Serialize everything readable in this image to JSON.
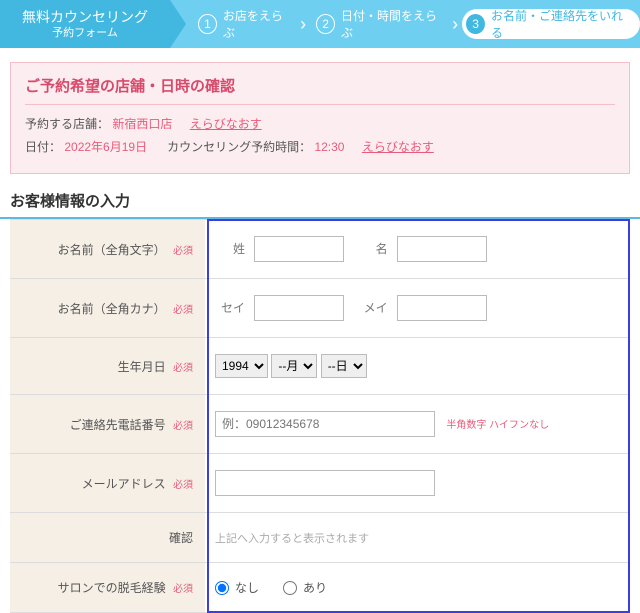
{
  "stepper": {
    "title_line1": "無料カウンセリング",
    "title_line2": "予約フォーム",
    "steps": [
      {
        "num": "1",
        "label": "お店をえらぶ",
        "active": false
      },
      {
        "num": "2",
        "label": "日付・時間をえらぶ",
        "active": false
      },
      {
        "num": "3",
        "label": "お名前・ご連絡先をいれる",
        "active": true
      }
    ]
  },
  "confirm": {
    "title": "ご予約希望の店舗・日時の確認",
    "shop_label": "予約する店舗：",
    "shop_value": "新宿西口店",
    "shop_change": "えらびなおす",
    "date_label": "日付：",
    "date_value": "2022年6月19日",
    "time_label": "カウンセリング予約時間：",
    "time_value": "12:30",
    "time_change": "えらびなおす"
  },
  "section_title": "お客様情報の入力",
  "form": {
    "required": "必須",
    "name": {
      "label": "お名前（全角文字）",
      "sei": "姓",
      "mei": "名"
    },
    "kana": {
      "label": "お名前（全角カナ）",
      "sei": "セイ",
      "mei": "メイ"
    },
    "birth": {
      "label": "生年月日",
      "year": "1994",
      "month": "--月",
      "day": "--日"
    },
    "phone": {
      "label": "ご連絡先電話番号",
      "placeholder": "例：09012345678",
      "hint": "半角数字 ハイフンなし"
    },
    "email": {
      "label": "メールアドレス",
      "confirm_label": "確認",
      "confirm_note": "上記へ入力すると表示されます"
    },
    "experience": {
      "label": "サロンでの脱毛経験",
      "none": "なし",
      "yes": "あり"
    }
  }
}
